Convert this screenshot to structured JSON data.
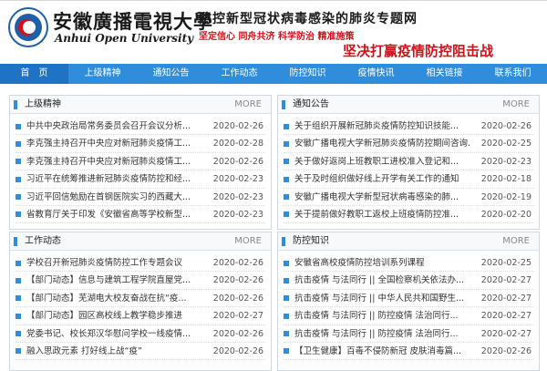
{
  "header": {
    "univ_name": "安徽廣播電視大學",
    "univ_en": "Anhui Open University",
    "topic_title": "防控新型冠状病毒感染的肺炎专题网",
    "slogan_line": "坚定信心 同舟共济 科学防治 精准施策",
    "banner_slogan": "坚决打赢疫情防控阻击战"
  },
  "nav": [
    {
      "label": "首　页"
    },
    {
      "label": "上级精神"
    },
    {
      "label": "通知公告"
    },
    {
      "label": "工作动态"
    },
    {
      "label": "防控知识"
    },
    {
      "label": "疫情快讯"
    },
    {
      "label": "相关链接"
    },
    {
      "label": "联系我们"
    }
  ],
  "more_label": "MORE",
  "panels": {
    "p1": {
      "title": "上级精神",
      "items": [
        {
          "title": "中共中央政治局常务委员会召开会议分析...",
          "date": "2020-02-26"
        },
        {
          "title": "李克强主持召开中央应对新冠肺炎疫情工...",
          "date": "2020-02-28"
        },
        {
          "title": "李克强主持召开中央应对新冠肺炎疫情工...",
          "date": "2020-02-26"
        },
        {
          "title": "习近平在统筹推进新冠肺炎疫情防控和经...",
          "date": "2020-02-23"
        },
        {
          "title": "习近平回信勉励在首钢医院实习的西藏大...",
          "date": "2020-02-23"
        },
        {
          "title": "省教育厅关于印发《安徽省高等学校新型...",
          "date": "2020-02-23"
        }
      ]
    },
    "p2": {
      "title": "通知公告",
      "items": [
        {
          "title": "关于组织开展新冠肺炎疫情防控知识技能...",
          "date": "2020-02-26"
        },
        {
          "title": "安徽广播电视大学新冠肺炎疫情防控期间咨询...",
          "date": "2020-02-25"
        },
        {
          "title": "关于做好返岗上班教职工进校准入登记和...",
          "date": "2020-02-23"
        },
        {
          "title": "关于及时组织做好线上开学有关工作的通知",
          "date": "2020-02-18"
        },
        {
          "title": "安徽广播电视大学新型冠状病毒感染的肺...",
          "date": "2020-02-19"
        },
        {
          "title": "关于提前做好教职工返校上班疫情防控准...",
          "date": "2020-02-20"
        }
      ]
    },
    "p3": {
      "title": "工作动态",
      "items": [
        {
          "title": "学校召开新冠肺炎疫情防控工作专题会议",
          "date": "2020-02-26"
        },
        {
          "title": "【部门动态】信息与建筑工程学院直屋党...",
          "date": "2020-02-26"
        },
        {
          "title": "【部门动态】芜湖电大校友奋战在抗“疫...",
          "date": "2020-02-26"
        },
        {
          "title": "【部门动态】园区高校线上教学稳步推进",
          "date": "2020-02-27"
        },
        {
          "title": "党委书记、校长郑汉华慰问学校一线疫情...",
          "date": "2020-02-26"
        },
        {
          "title": "融入思政元素 打好线上战“疫”",
          "date": "2020-02-26"
        }
      ]
    },
    "p4": {
      "title": "防控知识",
      "items": [
        {
          "title": "安徽省高校疫情防控培训系列课程",
          "date": "2020-02-25"
        },
        {
          "title": "抗击疫情 与法同行 || 全国检察机关依法办...",
          "date": "2020-02-27"
        },
        {
          "title": "抗击疫情 与法同行 || 中华人民共和国野生...",
          "date": "2020-02-27"
        },
        {
          "title": "抗击疫情 与法同行 || 防控疫情 法治同行...",
          "date": "2020-02-27"
        },
        {
          "title": "抗击疫情 与法同行 || 防控疫情 法治同行...",
          "date": "2020-02-27"
        },
        {
          "title": "【卫生健康】百毒不侵防新冠 皮肤消毒篇...",
          "date": "2020-02-26"
        }
      ]
    }
  },
  "colors": {
    "nav_blue": "#2f8ddb",
    "slogan_red": "#d0121b"
  }
}
